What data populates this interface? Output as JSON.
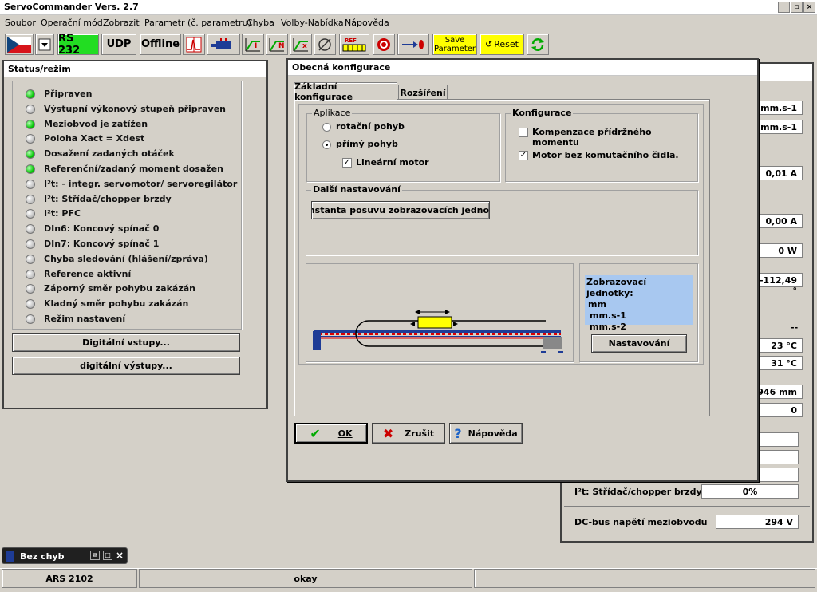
{
  "app": {
    "title": "ServoCommander Vers. 2.7"
  },
  "menu": [
    "Soubor",
    "Operační mód",
    "Zobrazit",
    "Parametr (č. parametru)",
    "Chyba",
    "Volby-Nabídka",
    "Nápověda"
  ],
  "toolbar": {
    "rs232": "RS 232",
    "udp": "UDP",
    "offline": "Offline",
    "ref": "REF",
    "save_line1": "Save",
    "save_line2": "Parameter",
    "reset": "Reset"
  },
  "status_panel": {
    "title": "Status/režim",
    "items": [
      {
        "label": "Připraven",
        "state": "on"
      },
      {
        "label": "Výstupní výkonový stupeň připraven",
        "state": "off"
      },
      {
        "label": "Meziobvod je zatížen",
        "state": "on"
      },
      {
        "label": "Poloha Xact = Xdest",
        "state": "off"
      },
      {
        "label": "Dosažení zadaných otáček",
        "state": "on"
      },
      {
        "label": "Referenční/zadaný moment dosažen",
        "state": "on"
      },
      {
        "label": "I²t: - integr. servomotor/ servoregilátor",
        "state": "off"
      },
      {
        "label": "I²t: Střídač/chopper brzdy",
        "state": "off"
      },
      {
        "label": "I²t: PFC",
        "state": "off"
      },
      {
        "label": "DIn6: Koncový spínač 0",
        "state": "off"
      },
      {
        "label": "DIn7: Koncový spínač 1",
        "state": "off"
      },
      {
        "label": "Chyba sledování  (hlášení/zpráva)",
        "state": "off"
      },
      {
        "label": "Reference aktivní",
        "state": "off"
      },
      {
        "label": "Záporný směr pohybu zakázán",
        "state": "off"
      },
      {
        "label": "Kladný směr pohybu zakázán",
        "state": "off"
      },
      {
        "label": "Režim nastavení",
        "state": "off"
      }
    ],
    "btn_inputs": "Digitální vstupy...",
    "btn_outputs": "digitální výstupy..."
  },
  "right_panel": {
    "f1": "mm.s-1",
    "f2": "mm.s-1",
    "f3": "0,01 A",
    "f4": "0,00 A",
    "f5": "0 W",
    "f6": "-112,49 °",
    "dash": "--",
    "f7": "23 °C",
    "f8": "31 °C",
    "f9": "946 mm",
    "f10": "0",
    "chopper_label": "I²t: Střídač/chopper brzdy",
    "chopper_value": "0%",
    "dcbus_label": "DC-bus  napětí meziobvodu",
    "dcbus_value": "294 V"
  },
  "dialog": {
    "title": "Obecná konfigurace",
    "tab1": "Základní konfigurace",
    "tab2": "Rozšíření",
    "aplikace": "Aplikace",
    "rotacni": "rotační pohyb",
    "primy": "přímý pohyb",
    "linearni": "Lineární motor",
    "konfigurace": "Konfigurace",
    "kompenzace": "Kompenzace přídržného momentu",
    "bezcidla": "Motor bez komutačního čidla.",
    "dalsi": "Další nastavování",
    "konstanta": "Konstanta posuvu zobrazovacích jednotek",
    "units_title": "Zobrazovací jednotky:",
    "unit1": "mm",
    "unit2": "mm.s-1",
    "unit3": "mm.s-2",
    "nastavovani": "Nastavování",
    "ok": "OK",
    "zrusit": "Zrušit",
    "napoveda": "Nápověda"
  },
  "mini_window": {
    "title": "Bez chyb"
  },
  "statusbar": {
    "device": "ARS 2102",
    "status": "okay"
  },
  "colors": {
    "led_on": "#08c808",
    "rs232_bg": "#22dd22",
    "save_bg": "#ffff00",
    "units_bg": "#a8c8f0"
  }
}
